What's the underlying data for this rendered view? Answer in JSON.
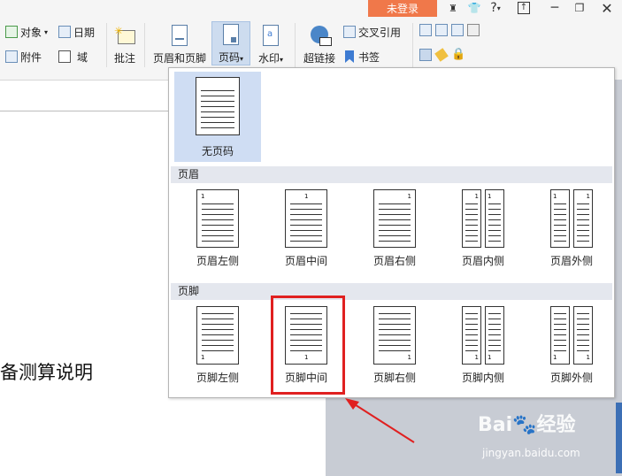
{
  "ribbon": {
    "object_label": "对象",
    "date_label": "日期",
    "attachment_label": "附件",
    "field_label": "域",
    "comment_label": "批注",
    "header_footer_label": "页眉和页脚",
    "page_number_label": "页码",
    "watermark_label": "水印",
    "hyperlink_label": "超链接",
    "cross_ref_label": "交叉引用",
    "bookmark_label": "书签"
  },
  "titlebar": {
    "login_label": "未登录",
    "help_label": "?"
  },
  "document": {
    "visible_text": "备测算说明"
  },
  "dropdown": {
    "none_option": "无页码",
    "header_section": "页眉",
    "footer_section": "页脚",
    "page_number_digit": "1",
    "header_options": [
      "页眉左侧",
      "页眉中间",
      "页眉右侧",
      "页眉内侧",
      "页眉外侧"
    ],
    "footer_options": [
      "页脚左侧",
      "页脚中间",
      "页脚右侧",
      "页脚内侧",
      "页脚外侧"
    ]
  },
  "watermark": {
    "brand": "Bai🐾经验",
    "url": "jingyan.baidu.com"
  },
  "colors": {
    "login_button": "#f0784a",
    "highlight_box": "#e02020",
    "selected_option": "#cfddf3"
  }
}
